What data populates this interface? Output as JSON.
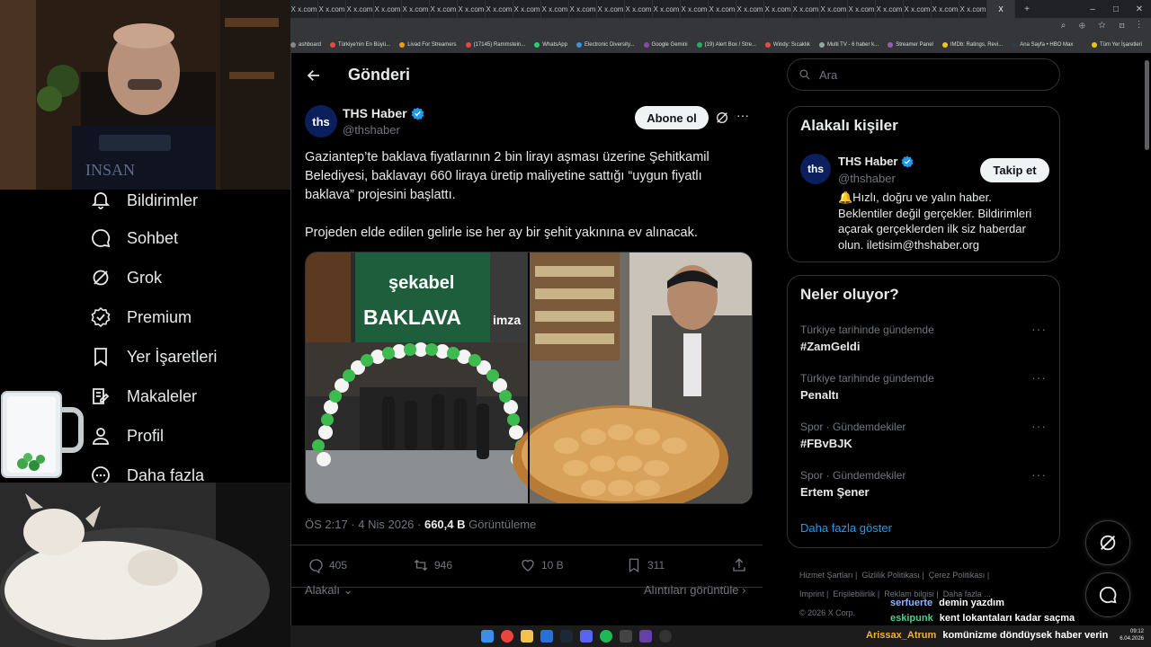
{
  "browser": {
    "tabs": [
      "X x.com",
      "X x.com",
      "X x.com",
      "X x.com",
      "X x.com",
      "X x.com",
      "X x.com",
      "X x.com",
      "X x.com",
      "X x.com",
      "X x.com",
      "X x.com",
      "X x.com",
      "X x.com",
      "X x.com",
      "X x.com",
      "X x.com",
      "X x.com",
      "X x.com",
      "X x.com",
      "X x.com",
      "X x.com",
      "X x.com",
      "X x.com",
      "X x.com",
      "X"
    ],
    "new_tab": "+",
    "bookmarks": [
      "ashboard",
      "Türkiye'nin En Büyü...",
      "Livad For Streamers",
      "(17145) Rammstein...",
      "WhatsApp",
      "Electronic Diversity...",
      "Google Gemini",
      "(19) Alert Box / Stre...",
      "Windy: Sıcaklık",
      "Multi TV - 6 haber k...",
      "Streamer Panel",
      "IMDb: Ratings, Revi...",
      "Ana Sayfa • HBO Max",
      "Tüm Yer İşaretleri"
    ]
  },
  "nav": {
    "items": [
      {
        "label": "Bildirimler",
        "icon": "bell-icon"
      },
      {
        "label": "Sohbet",
        "icon": "chat-icon"
      },
      {
        "label": "Grok",
        "icon": "grok-icon"
      },
      {
        "label": "Premium",
        "icon": "premium-icon"
      },
      {
        "label": "Yer İşaretleri",
        "icon": "bookmark-icon"
      },
      {
        "label": "Makaleler",
        "icon": "articles-icon"
      },
      {
        "label": "Profil",
        "icon": "profile-icon"
      },
      {
        "label": "Daha fazla",
        "icon": "more-icon"
      }
    ]
  },
  "post": {
    "header_title": "Gönderi",
    "author_name": "THS Haber",
    "author_handle": "@thshaber",
    "avatar_text": "ths",
    "subscribe_label": "Abone ol",
    "text_p1": "Gaziantep’te baklava fiyatlarının 2 bin lirayı aşması üzerine Şehitkamil Belediyesi, baklavayı 660 liraya üretip maliyetine sattığı “uygun fiyatlı baklava” projesini başlattı.",
    "text_p2": "Projeden elde edilen gelirle ise her ay bir şehit yakınına ev alınacak.",
    "image_sign_brand": "şekabel",
    "image_sign_main": "BAKLAVA",
    "image_sign_side": "imza",
    "time": "ÖS 2:17 · 4 Nis 2026 ·",
    "views_count": "660,4 B",
    "views_label": "Görüntüleme",
    "replies": "405",
    "reposts": "946",
    "likes": "10 B",
    "bookmarks": "311",
    "relevance_label": "Alakalı",
    "quotes_label": "Alıntıları görüntüle"
  },
  "sidebar": {
    "search_placeholder": "Ara",
    "related_title": "Alakalı kişiler",
    "related_name": "THS Haber",
    "related_handle": "@thshaber",
    "follow_label": "Takip et",
    "related_bio": "🔔Hızlı, doğru ve yalın haber. Beklentiler değil gerçekler. Bildirimleri açarak gerçeklerden ilk siz haberdar olun. iletisim@thshaber.org",
    "trends_title": "Neler oluyor?",
    "trends": [
      {
        "category": "Türkiye tarihinde gündemde",
        "name": "#ZamGeldi"
      },
      {
        "category": "Türkiye tarihinde gündemde",
        "name": "Penaltı"
      },
      {
        "category": "Spor · Gündemdekiler",
        "name": "#FBvBJK"
      },
      {
        "category": "Spor · Gündemdekiler",
        "name": "Ertem Şener"
      }
    ],
    "show_more": "Daha fazla göster",
    "footer_links": [
      "Hizmet Şartları",
      "Gizlilik Politikası",
      "Çerez Politikası",
      "Imprint",
      "Erişilebilirlik",
      "Reklam bilgisi",
      "Daha fazla ..."
    ],
    "copyright": "© 2026 X Corp."
  },
  "chat": [
    {
      "user": "serfuerte",
      "message": "demin yazdım",
      "color": "#8fb6ff"
    },
    {
      "user": "eskipunk",
      "message": "kent lokantaları kadar saçma",
      "color": "#4dd08a"
    },
    {
      "user": "Arissax_Atrum",
      "message": "komünizme döndüysek haber verin",
      "color": "#f2b230"
    }
  ],
  "system": {
    "clock_time": "09:12",
    "clock_date": "6.04.2026"
  },
  "colors": {
    "accent": "#1d9bf0",
    "background": "#000000",
    "border": "#2f3336",
    "muted": "#71767b"
  }
}
